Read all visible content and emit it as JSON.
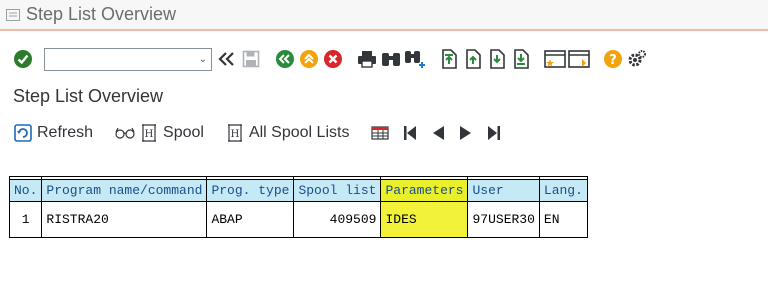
{
  "window": {
    "title": "Step List Overview"
  },
  "toolbar": {
    "command_field": {
      "value": "",
      "dropdown_glyph": "⌄"
    },
    "icons": [
      "check-icon",
      "back-double-icon",
      "save-icon",
      "back-icon",
      "exit-icon",
      "cancel-icon",
      "print-icon",
      "find-icon",
      "find-next-icon",
      "first-page-icon",
      "previous-page-icon",
      "next-page-icon",
      "last-page-icon",
      "new-session-icon",
      "shortcut-icon",
      "help-icon",
      "settings-icon"
    ]
  },
  "page": {
    "subtitle": "Step List Overview"
  },
  "app_toolbar": {
    "refresh_label": "Refresh",
    "spool_label": "Spool",
    "all_spool_label": "All Spool Lists"
  },
  "table": {
    "headers": [
      "No.",
      "Program name/command",
      "Prog. type",
      "Spool list",
      "Parameters",
      "User",
      "Lang."
    ],
    "rows": [
      [
        "1",
        "RISTRA20",
        "ABAP",
        "409509",
        "IDES",
        "97USER30",
        "EN"
      ]
    ],
    "highlight_color": "#f2f23a",
    "header_color": "#c6e9f6"
  }
}
